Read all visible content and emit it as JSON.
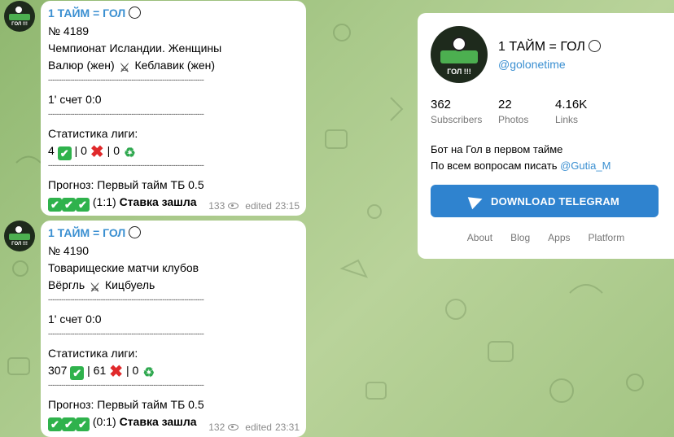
{
  "channel": {
    "name": "1 ТАЙМ = ГОЛ",
    "handle": "@golonetime",
    "avatar_text": "ГОЛ !!!",
    "stats": [
      {
        "value": "362",
        "label": "Subscribers"
      },
      {
        "value": "22",
        "label": "Photos"
      },
      {
        "value": "4.16K",
        "label": "Links"
      }
    ],
    "description_line1": "Бот на Гол в первом тайме",
    "description_line2_prefix": "По всем вопросам писать ",
    "description_link": "@Gutia_M",
    "download_label": "DOWNLOAD TELEGRAM",
    "footer_links": [
      "About",
      "Blog",
      "Apps",
      "Platform"
    ]
  },
  "posts": [
    {
      "author": "1 ТАЙМ = ГОЛ",
      "number": "№ 4189",
      "league": "Чемпионат Исландии. Женщины",
      "team1": "Валюр (жен)",
      "team2": "Кеблавик (жен)",
      "separator": "-----------------------------------------------------------------------",
      "score": "1' счет 0:0",
      "stats_title": "Статистика лиги:",
      "stat_wins": "4",
      "stat_losses": "| 0",
      "stat_returns": "| 0",
      "forecast": "Прогноз: Первый тайм ТБ 0.5",
      "result_score": "(1:1)",
      "result_text": "Ставка зашла",
      "views": "133",
      "edited": "edited",
      "time": "23:15"
    },
    {
      "author": "1 ТАЙМ = ГОЛ",
      "number": "№ 4190",
      "league": "Товарищеские матчи клубов",
      "team1": "Вёргль",
      "team2": "Кицбуель",
      "separator": "-----------------------------------------------------------------------",
      "score": "1' счет 0:0",
      "stats_title": "Статистика лиги:",
      "stat_wins": "307",
      "stat_losses": "| 61",
      "stat_returns": "| 0",
      "forecast": "Прогноз: Первый тайм ТБ 0.5",
      "result_score": "(0:1)",
      "result_text": "Ставка зашла",
      "views": "132",
      "edited": "edited",
      "time": "23:31"
    }
  ]
}
